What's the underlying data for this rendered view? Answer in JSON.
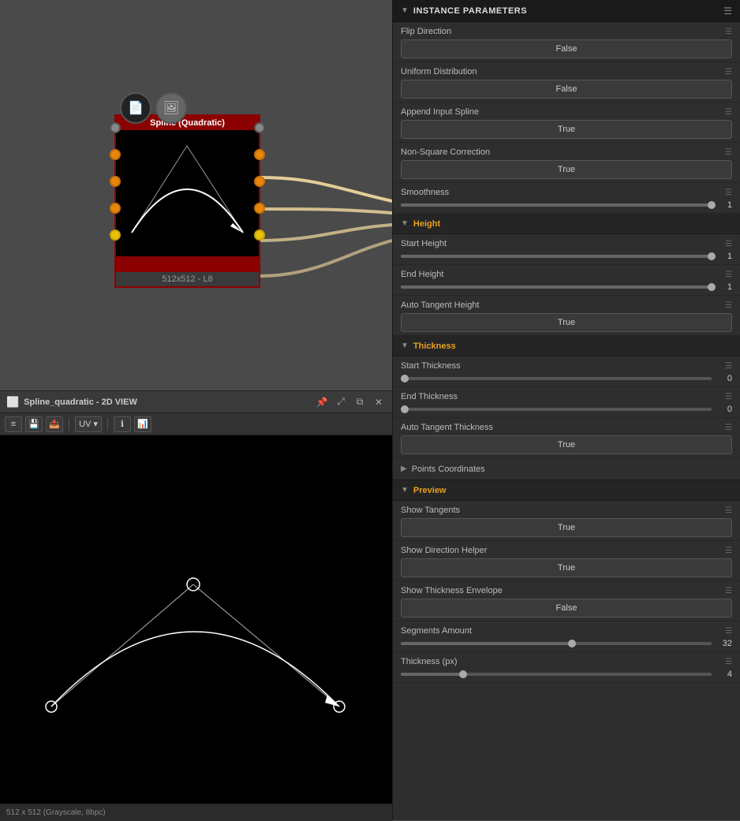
{
  "node": {
    "title": "Spline (Quadratic)",
    "label": "512x512 - L8"
  },
  "view_panel": {
    "title": "Spline_quadratic - 2D VIEW",
    "status": "512 x 512 (Grayscale, 8bpc)"
  },
  "params": {
    "header": "INSTANCE PARAMETERS",
    "flip_direction": {
      "label": "Flip Direction",
      "value": "False"
    },
    "uniform_distribution": {
      "label": "Uniform Distribution",
      "value": "False"
    },
    "append_input_spline": {
      "label": "Append Input Spline",
      "value": "True"
    },
    "non_square_correction": {
      "label": "Non-Square Correction",
      "value": "True"
    },
    "smoothness": {
      "label": "Smoothness",
      "value": "1",
      "pct": 100
    },
    "height_section": "Height",
    "start_height": {
      "label": "Start Height",
      "value": "1",
      "pct": 100
    },
    "end_height": {
      "label": "End Height",
      "value": "1",
      "pct": 100
    },
    "auto_tangent_height": {
      "label": "Auto Tangent Height",
      "value": "True"
    },
    "thickness_section": "Thickness",
    "start_thickness": {
      "label": "Start Thickness",
      "value": "0",
      "pct": 0
    },
    "end_thickness": {
      "label": "End Thickness",
      "value": "0",
      "pct": 0
    },
    "auto_tangent_thickness": {
      "label": "Auto Tangent Thickness",
      "value": "True"
    },
    "points_coordinates": {
      "label": "Points Coordinates",
      "collapsed": true
    },
    "preview_section": "Preview",
    "show_tangents": {
      "label": "Show Tangents",
      "value": "True"
    },
    "show_direction_helper": {
      "label": "Show Direction Helper",
      "value": "True"
    },
    "show_thickness_envelope": {
      "label": "Show Thickness Envelope",
      "value": "False"
    },
    "segments_amount": {
      "label": "Segments Amount",
      "value": "32",
      "pct": 55
    },
    "thickness_px": {
      "label": "Thickness (px)",
      "value": "4",
      "pct": 20
    }
  }
}
